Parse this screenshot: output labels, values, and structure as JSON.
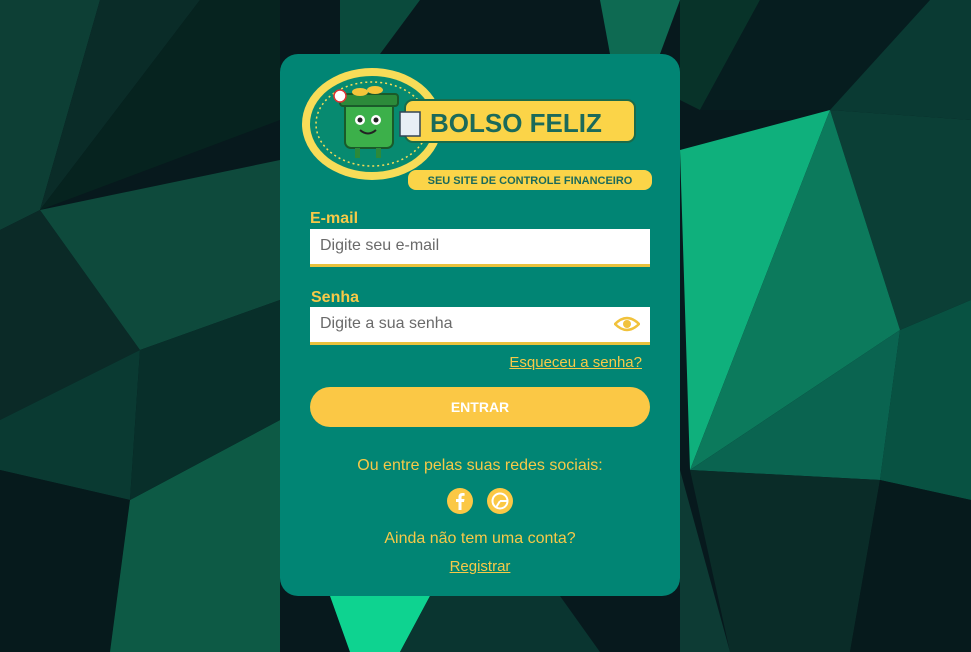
{
  "brand": {
    "name": "BOLSO FELIZ",
    "tagline": "SEU SITE DE CONTROLE FINANCEIRO"
  },
  "form": {
    "email_label": "E-mail",
    "email_placeholder": "Digite seu e-mail",
    "password_label": "Senha",
    "password_placeholder": "Digite a sua senha",
    "forgot_label": "Esqueceu a senha?",
    "submit_label": "ENTRAR"
  },
  "social": {
    "prompt": "Ou entre pelas suas redes sociais:",
    "icons": [
      "facebook-icon",
      "google-icon"
    ]
  },
  "signup": {
    "prompt": "Ainda não tem uma conta?",
    "link_label": "Registrar"
  },
  "colors": {
    "card": "#018574",
    "accent": "#fbc845",
    "background": "#06181c"
  }
}
